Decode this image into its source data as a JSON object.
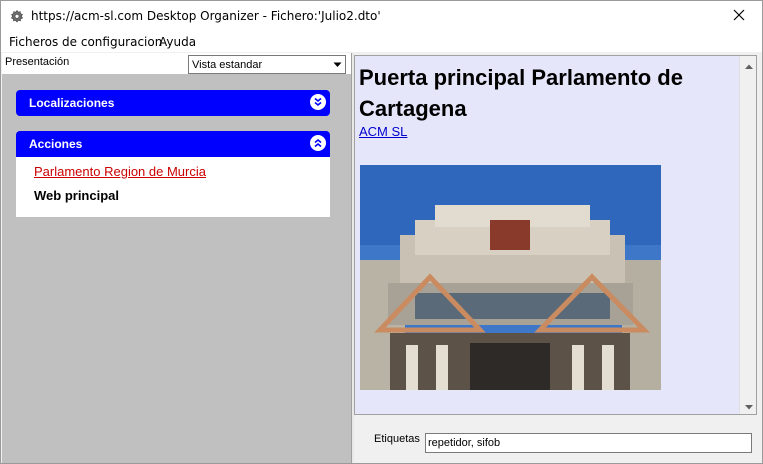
{
  "window": {
    "title": "https://acm-sl.com Desktop Organizer - Fichero:'Julio2.dto'"
  },
  "menu": {
    "items": [
      "Ficheros de configuracion",
      "Ayuda"
    ]
  },
  "left": {
    "presentation_label": "Presentación",
    "view_select": {
      "value": "Vista estandar"
    },
    "panels": [
      {
        "title": "Localizaciones",
        "expanded": false
      },
      {
        "title": "Acciones",
        "expanded": true,
        "items": [
          "Parlamento Region de Murcia",
          "Web principal"
        ]
      }
    ]
  },
  "content": {
    "heading": "Puerta principal Parlamento de Cartagena",
    "link": "ACM SL"
  },
  "tags": {
    "label": "Etiquetas",
    "value": "repetidor, sifob"
  },
  "colors": {
    "panel_header": "#0000ff",
    "content_bg": "#e6e6fa",
    "left_bg": "#c0c0c0",
    "link_red": "#cc0000",
    "link_blue": "#0000cc"
  }
}
